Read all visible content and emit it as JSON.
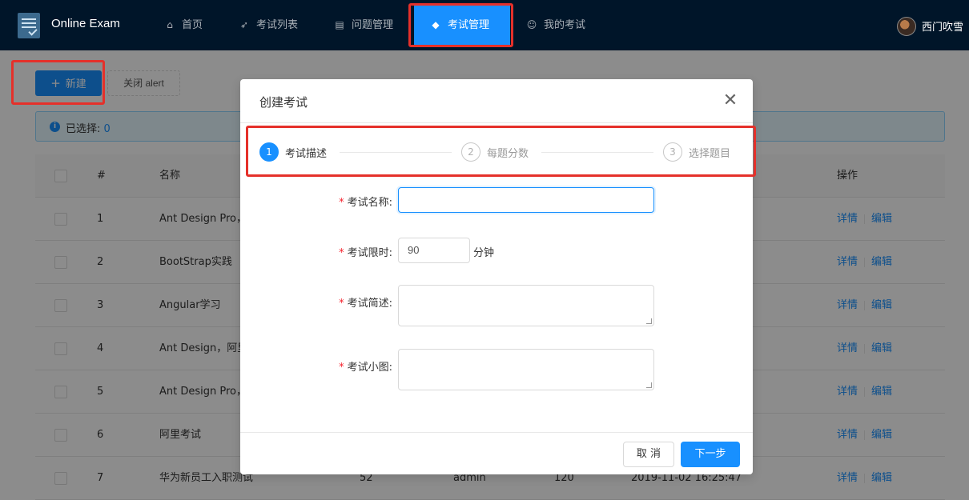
{
  "header": {
    "app_title": "Online Exam",
    "nav": [
      {
        "label": "首页",
        "icon": "home-icon"
      },
      {
        "label": "考试列表",
        "icon": "rocket-icon"
      },
      {
        "label": "问题管理",
        "icon": "file-icon"
      },
      {
        "label": "考试管理",
        "icon": "stack-icon",
        "active": true
      },
      {
        "label": "我的考试",
        "icon": "user-icon"
      }
    ],
    "user_name": "西门吹雪"
  },
  "toolbar": {
    "new_label": "新建",
    "close_alert_label": "关闭 alert"
  },
  "alert": {
    "prefix": "已选择:",
    "count": "0"
  },
  "table": {
    "columns": [
      "#",
      "名称",
      "操作"
    ],
    "rows": [
      {
        "index": "1",
        "name": "Ant Design Pro，",
        "detail": "详情",
        "edit": "编辑"
      },
      {
        "index": "2",
        "name": "BootStrap实践",
        "detail": "详情",
        "edit": "编辑"
      },
      {
        "index": "3",
        "name": "Angular学习",
        "detail": "详情",
        "edit": "编辑"
      },
      {
        "index": "4",
        "name": "Ant Design，阿里",
        "detail": "详情",
        "edit": "编辑"
      },
      {
        "index": "5",
        "name": "Ant Design Pro，",
        "detail": "详情",
        "edit": "编辑"
      },
      {
        "index": "6",
        "name": "阿里考试",
        "detail": "详情",
        "edit": "编辑"
      },
      {
        "index": "7",
        "name": "华为新员工入职测试",
        "score": "52",
        "creator": "admin",
        "minutes": "120",
        "date": "2019-11-02 16:25:47",
        "detail": "详情",
        "edit": "编辑"
      }
    ]
  },
  "modal": {
    "title": "创建考试",
    "close_glyph": "✕",
    "steps": [
      {
        "num": "1",
        "label": "考试描述",
        "state": "current"
      },
      {
        "num": "2",
        "label": "每题分数",
        "state": "wait"
      },
      {
        "num": "3",
        "label": "选择题目",
        "state": "wait"
      }
    ],
    "form": {
      "name_label": "考试名称:",
      "name_value": "",
      "time_label": "考试限时:",
      "time_value": "90",
      "time_unit": "分钟",
      "desc_label": "考试简述:",
      "desc_value": "",
      "image_label": "考试小图:",
      "image_value": "",
      "required_mark": "*"
    },
    "footer": {
      "cancel_label": "取 消",
      "next_label": "下一步"
    }
  },
  "colors": {
    "primary": "#1890ff",
    "header_bg": "#001529",
    "highlight": "#e5302a",
    "required": "#f5222d"
  }
}
